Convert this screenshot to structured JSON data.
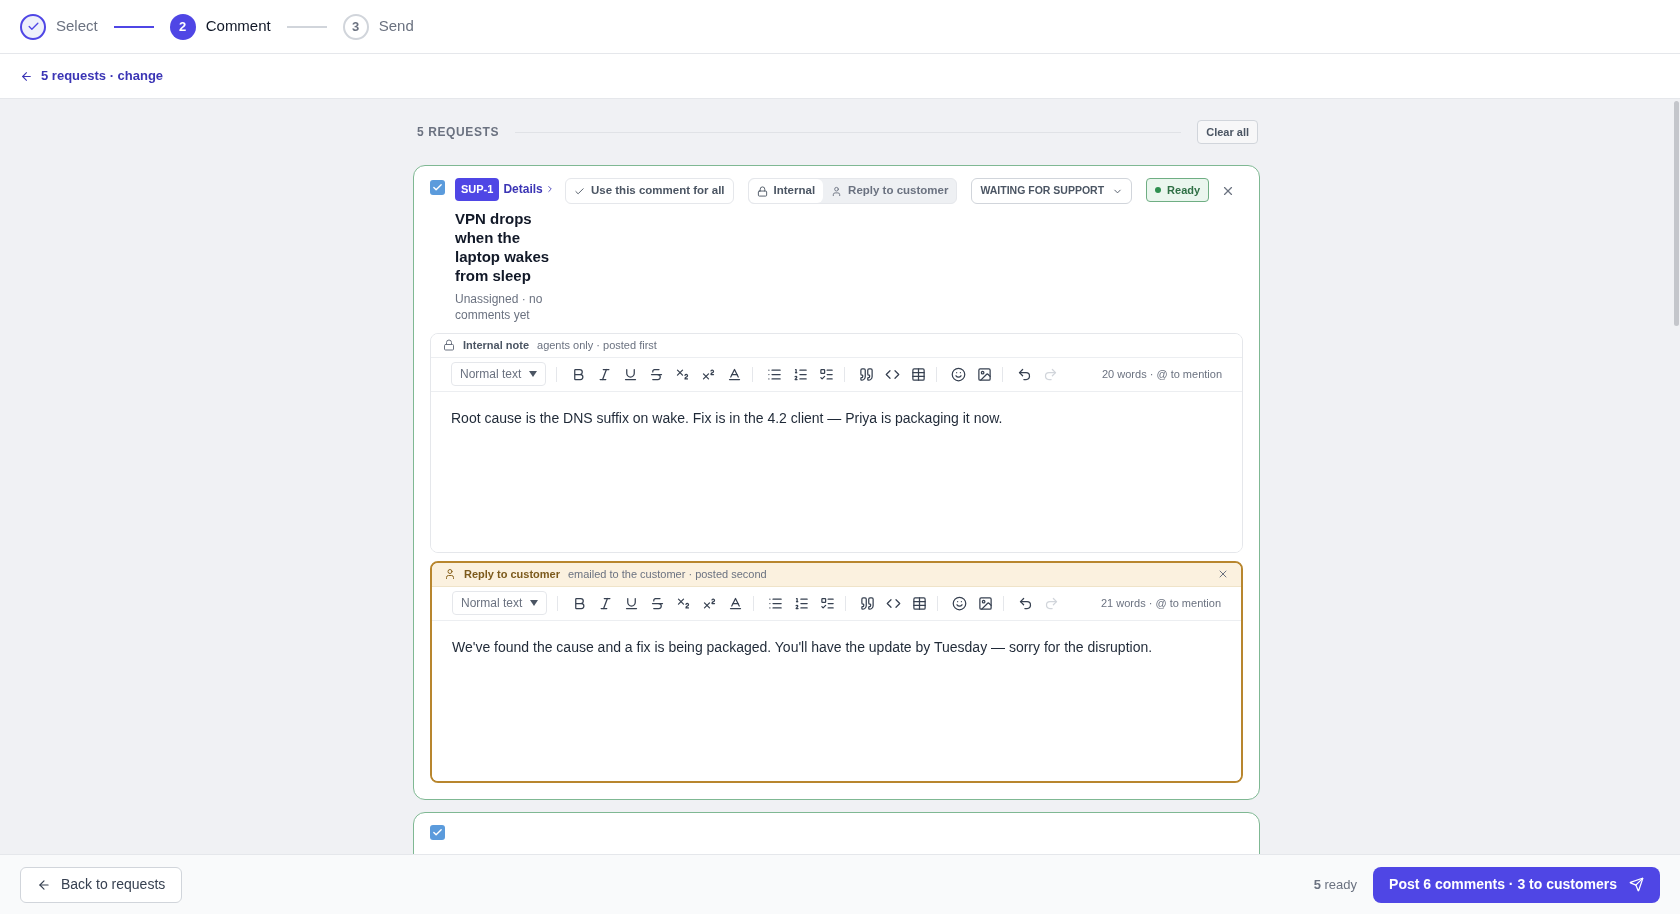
{
  "stepper": [
    {
      "kind": "done",
      "label": "Select"
    },
    {
      "kind": "current",
      "number": "2",
      "label": "Comment"
    },
    {
      "kind": "upcoming",
      "number": "3",
      "label": "Send"
    }
  ],
  "back_link": "5 requests · change",
  "section": {
    "title": "5 REQUESTS",
    "clear_button": "Clear all"
  },
  "requests": [
    {
      "checked": true,
      "key": "SUP-1",
      "details_link": "Details",
      "title": "VPN drops when the laptop wakes from sleep",
      "meta": "Unassigned · no comments yet",
      "use_for_all": "Use this comment for all",
      "audience": [
        {
          "label": "Internal",
          "selected": true
        },
        {
          "label": "Reply to customer",
          "selected": false
        }
      ],
      "status": "WAITING FOR SUPPORT",
      "ready_badge": "Ready",
      "editors": [
        {
          "kind": "internal",
          "title": "Internal note",
          "subtitle": "agents only · posted first",
          "format": "Normal text",
          "word_count": "20 words · @ to mention",
          "body": "Root cause is the DNS suffix on wake. Fix is in the 4.2 client — Priya is packaging it now.",
          "redo_enabled": false,
          "closable": false
        },
        {
          "kind": "customer",
          "title": "Reply to customer",
          "subtitle": "emailed to the customer · posted second",
          "format": "Normal text",
          "word_count": "21 words · @ to mention",
          "body": "We've found the cause and a fix is being packaged. You'll have the update by Tuesday — sorry for the disruption.",
          "redo_enabled": false,
          "closable": true
        }
      ]
    },
    {
      "checked": true
    }
  ],
  "footer": {
    "back_button": "Back to requests",
    "ready_count": "**5** ready",
    "post_button": "Post 6 comments · 3 to customers"
  }
}
